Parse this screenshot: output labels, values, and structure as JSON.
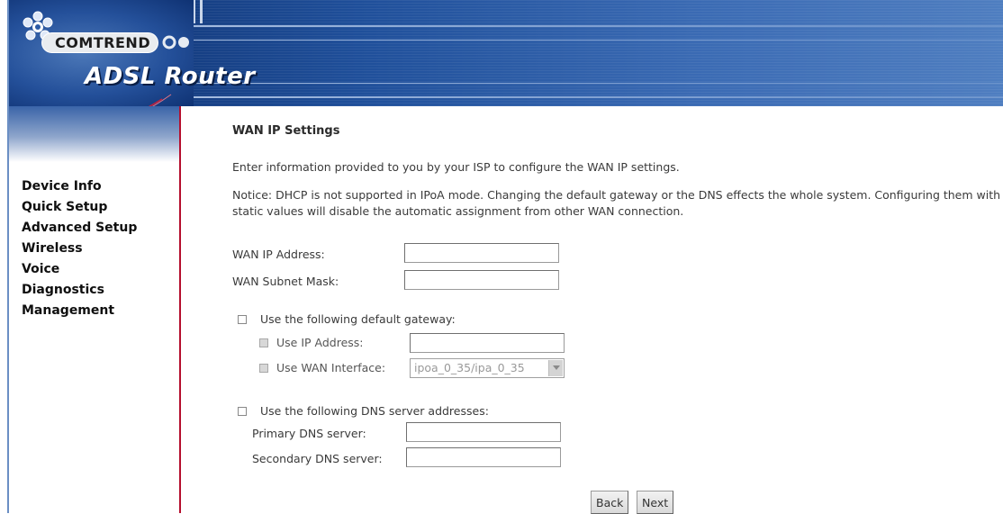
{
  "header": {
    "brand": "COMTREND",
    "product": "ADSL Router"
  },
  "sidebar": {
    "items": [
      {
        "label": "Device Info"
      },
      {
        "label": "Quick Setup"
      },
      {
        "label": "Advanced Setup"
      },
      {
        "label": "Wireless"
      },
      {
        "label": "Voice"
      },
      {
        "label": "Diagnostics"
      },
      {
        "label": "Management"
      }
    ]
  },
  "main": {
    "title": "WAN IP Settings",
    "intro": "Enter information provided to you by your ISP to configure the WAN IP settings.",
    "notice": "Notice: DHCP is not supported in IPoA mode. Changing the default gateway or the DNS effects the whole system. Configuring them with static values will disable the automatic assignment from other WAN connection.",
    "wan_ip_label": "WAN IP Address:",
    "wan_ip_value": "",
    "subnet_label": "WAN Subnet Mask:",
    "subnet_value": "",
    "gateway": {
      "checkbox_label": "Use the following default gateway:",
      "checked": false,
      "use_ip_label": "Use IP Address:",
      "use_ip_value": "",
      "use_wan_label": "Use WAN Interface:",
      "wan_interface_selected": "ipoa_0_35/ipa_0_35"
    },
    "dns": {
      "checkbox_label": "Use the following DNS server addresses:",
      "checked": false,
      "primary_label": "Primary DNS server:",
      "primary_value": "",
      "secondary_label": "Secondary DNS server:",
      "secondary_value": ""
    },
    "buttons": {
      "back": "Back",
      "next": "Next"
    }
  },
  "colors": {
    "banner": "#1f4f9a",
    "divider": "#b50f2e"
  }
}
